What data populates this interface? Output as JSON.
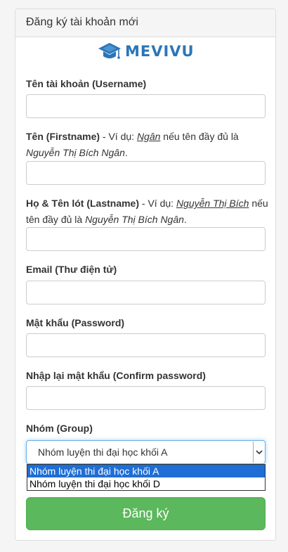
{
  "panel": {
    "title": "Đăng ký tài khoản mới"
  },
  "logo": {
    "text": "MEVIVU",
    "icon": "graduation-cap-icon"
  },
  "form": {
    "username": {
      "label": "Tên tài khoản (Username)",
      "value": ""
    },
    "firstname": {
      "label": "Tên (Firstname)",
      "note_pre": " - Ví dụ: ",
      "example": "Ngân",
      "note_mid": " nếu tên đầy đủ là ",
      "fullname": "Nguyễn Thị Bích Ngân",
      "note_end": ".",
      "value": ""
    },
    "lastname": {
      "label": "Họ & Tên lót (Lastname)",
      "note_pre": " - Ví dụ: ",
      "example": "Nguyễn Thị Bích",
      "note_mid": " nếu tên đầy đủ là ",
      "fullname": "Nguyễn Thị Bích Ngân",
      "note_end": ".",
      "value": ""
    },
    "email": {
      "label": "Email (Thư điện tử)",
      "value": ""
    },
    "password": {
      "label": "Mật khẩu (Password)",
      "value": ""
    },
    "confirm_password": {
      "label": "Nhập lại mật khẩu (Confirm password)",
      "value": ""
    },
    "group": {
      "label": "Nhóm (Group)",
      "selected": "Nhóm luyện thi đại học khối A",
      "options": [
        "Nhóm luyện thi đại học khối A",
        "Nhóm luyện thi đại học khối D"
      ]
    },
    "submit_label": "Đăng ký"
  },
  "colors": {
    "brand": "#2a76b8",
    "submit": "#5cb85c",
    "option_highlight": "#1e6ed6"
  }
}
